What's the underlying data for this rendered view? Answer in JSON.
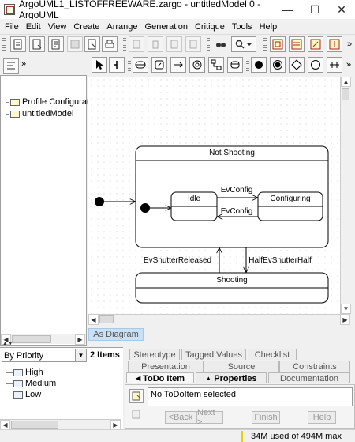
{
  "window": {
    "title": "ArgoUML1_LISTOFFREEWARE.zargo - untitledModel 0 - ArgoUML",
    "minimize": "—",
    "maximize": "☐",
    "close": "✕"
  },
  "menu": [
    "File",
    "Edit",
    "View",
    "Create",
    "Arrange",
    "Generation",
    "Critique",
    "Tools",
    "Help"
  ],
  "explorer": {
    "items": [
      "Profile Configuration",
      "untitledModel"
    ]
  },
  "diagram": {
    "tab_label": "As Diagram",
    "composite_state": "Not Shooting",
    "state_idle": "Idle",
    "state_configuring": "Configuring",
    "state_shooting": "Shooting",
    "t_evconfig_1": "EvConfig",
    "t_evconfig_2": "EvConfig",
    "t_shutter_released": "EvShutterReleased",
    "t_shutter_half": "HalfEvShutterHalf"
  },
  "todo": {
    "sort_value": "By Priority",
    "count": "2 Items",
    "groups": [
      "High",
      "Medium",
      "Low"
    ]
  },
  "details": {
    "tabs_row1": [
      "Stereotype",
      "Tagged Values",
      "Checklist"
    ],
    "tabs_row2": [
      "Presentation",
      "Source",
      "Constraints"
    ],
    "tabs_row3": [
      "ToDo Item",
      "Properties",
      "Documentation"
    ],
    "message": "No ToDoItem selected",
    "back": "<Back",
    "next": "Next >",
    "finish": "Finish",
    "help": "Help"
  },
  "status": {
    "memory": "34M used of 494M max"
  },
  "colors": {
    "tab_blue": "#c9e0f5",
    "memory_bar": "#e6d000"
  }
}
